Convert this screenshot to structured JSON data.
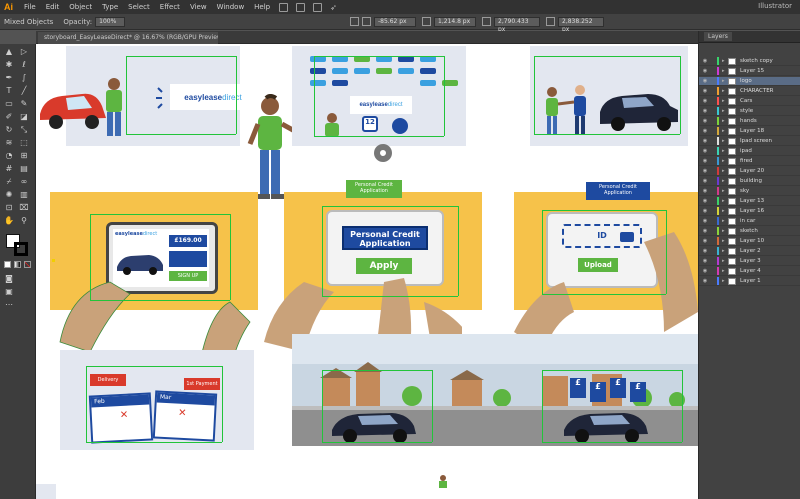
{
  "app": {
    "logo": "Ai",
    "workspace": "Illustrator",
    "menus": [
      "File",
      "Edit",
      "Object",
      "Type",
      "Select",
      "Effect",
      "View",
      "Window",
      "Help"
    ]
  },
  "controlbar": {
    "selection": "Mixed Objects",
    "opacity_label": "Opacity:",
    "opacity_value": "100%",
    "x_value": "-85.62 px",
    "y_value": "1,214.8 px",
    "w_value": "2,790.433 px",
    "h_value": "2,838.252 px"
  },
  "document": {
    "tab_title": "storyboard_EasyLeaseDirect* @ 16.67% (RGB/GPU Preview)"
  },
  "canvas": {
    "brand": {
      "easy": "easylease",
      "direct": "direct"
    },
    "personal_credit_label": "Personal Credit Application",
    "apply_label": "Apply",
    "id_label": "ID",
    "upload_label": "Upload",
    "price_label": "£169.00",
    "sign_up_label": "SIGN UP",
    "delivery_label": "Delivery",
    "first_payment_label": "1st Payment",
    "months": [
      "Feb",
      "Mar"
    ],
    "twelve_label": "12",
    "signs": [
      "£",
      "£",
      "£",
      "£"
    ]
  },
  "colors": {
    "orange_panel": "#f6c24a",
    "pale_panel": "#e3e7f0",
    "blue_dark": "#1e4aa0",
    "green_btn": "#5db541",
    "guide": "#22c43a",
    "car_dark": "#1f2538"
  },
  "layers": {
    "panel_title": "Layers",
    "items": [
      {
        "name": "sketch copy",
        "color": "#38d46c"
      },
      {
        "name": "Layer 15",
        "color": "#cf3ad4"
      },
      {
        "name": "logo",
        "color": "#4a7cff",
        "selected": true
      },
      {
        "name": "CHARACTER",
        "color": "#f0a030"
      },
      {
        "name": "Cars",
        "color": "#ff5050"
      },
      {
        "name": "style",
        "color": "#38c9d4"
      },
      {
        "name": "hands",
        "color": "#7ad43a"
      },
      {
        "name": "Layer 18",
        "color": "#d4a83a"
      },
      {
        "name": "Ipad screen",
        "color": "#e0e0e0"
      },
      {
        "name": "ipad",
        "color": "#3ad4b4"
      },
      {
        "name": "fired",
        "color": "#3a9ad4"
      },
      {
        "name": "Layer 20",
        "color": "#d43a3a"
      },
      {
        "name": "building",
        "color": "#6a3ad4"
      },
      {
        "name": "sky",
        "color": "#d43a8a"
      },
      {
        "name": "Layer 13",
        "color": "#3ad46a"
      },
      {
        "name": "Layer 16",
        "color": "#d4d43a"
      },
      {
        "name": "in car",
        "color": "#3a6ad4"
      },
      {
        "name": "sketch",
        "color": "#8ad43a"
      },
      {
        "name": "Layer 10",
        "color": "#d46a3a"
      },
      {
        "name": "Layer 2",
        "color": "#3ab4d4"
      },
      {
        "name": "Layer 3",
        "color": "#b43ad4"
      },
      {
        "name": "Layer 4",
        "color": "#d43ab4"
      },
      {
        "name": "Layer 1",
        "color": "#4a7cff"
      }
    ]
  }
}
